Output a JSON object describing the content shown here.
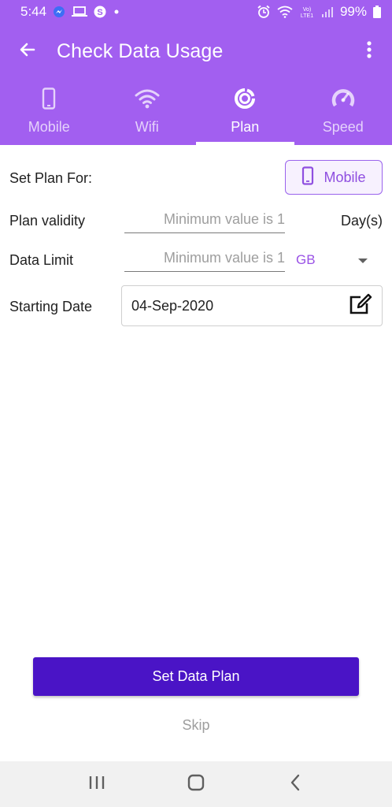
{
  "colors": {
    "primary": "#a25ff0",
    "button": "#4a14c6",
    "accent": "#9a52e6"
  },
  "status_bar": {
    "time": "5:44",
    "battery": "99%",
    "icons": [
      "messenger-icon",
      "laptop-icon",
      "skype-icon",
      "dot-icon",
      "alarm-icon",
      "wifi-icon",
      "volte-lte-icon",
      "signal-icon",
      "battery-icon"
    ]
  },
  "app_bar": {
    "title": "Check Data Usage",
    "back_icon": "arrow-left-icon",
    "menu_icon": "more-vert-icon"
  },
  "tabs": [
    {
      "label": "Mobile",
      "icon": "phone-icon",
      "active": false
    },
    {
      "label": "Wifi",
      "icon": "wifi-icon",
      "active": false
    },
    {
      "label": "Plan",
      "icon": "plan-icon",
      "active": true
    },
    {
      "label": "Speed",
      "icon": "speedometer-icon",
      "active": false
    }
  ],
  "form": {
    "set_plan_for_label": "Set Plan For:",
    "plan_mode_button": "Mobile",
    "plan_validity_label": "Plan validity",
    "plan_validity_placeholder": "Minimum value is 1",
    "plan_validity_value": "",
    "plan_validity_unit": "Day(s)",
    "data_limit_label": "Data Limit",
    "data_limit_placeholder": "Minimum value is 1",
    "data_limit_value": "",
    "data_unit": "GB",
    "starting_date_label": "Starting Date",
    "starting_date_value": "04-Sep-2020"
  },
  "actions": {
    "set_plan_label": "Set Data Plan",
    "skip_label": "Skip"
  },
  "nav_bar": {
    "icons": [
      "recents-icon",
      "home-icon",
      "back-icon"
    ]
  }
}
